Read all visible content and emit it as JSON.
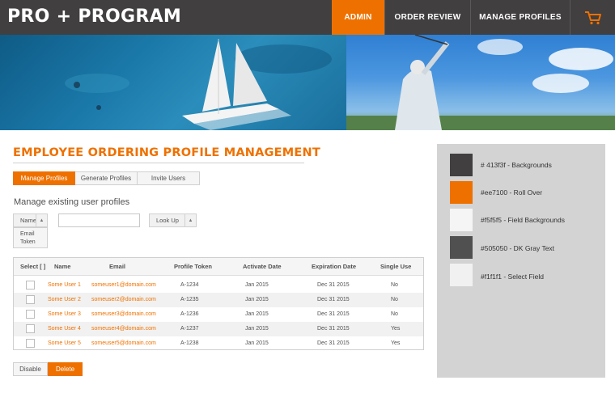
{
  "header": {
    "logo": "PRO + PROGRAM",
    "nav": [
      {
        "label": "ADMIN",
        "active": true
      },
      {
        "label": "ORDER REVIEW",
        "active": false
      },
      {
        "label": "MANAGE PROFILES",
        "active": false
      }
    ],
    "cart_icon": "shopping-cart-icon"
  },
  "page": {
    "title": "EMPLOYEE ORDERING PROFILE MANAGEMENT",
    "tabs": [
      {
        "label": "Manage Profiles",
        "active": true
      },
      {
        "label": "Generate Profiles",
        "active": false
      },
      {
        "label": "Invite Users",
        "active": false
      }
    ],
    "subtitle": "Manage existing user profiles"
  },
  "search": {
    "field_select": "Name",
    "field_options": [
      "Email",
      "Token"
    ],
    "query": "",
    "lookup_label": "Look Up"
  },
  "table": {
    "columns": [
      "Select [ ]",
      "Name",
      "Email",
      "Profile Token",
      "Activate Date",
      "Expiration Date",
      "Single Use"
    ],
    "rows": [
      {
        "name": "Some User 1",
        "email": "someuser1@domain.com",
        "token": "A-1234",
        "activate": "Jan 2015",
        "expiration": "Dec 31 2015",
        "single_use": "No"
      },
      {
        "name": "Some User 2",
        "email": "someuser2@domain.com",
        "token": "A-1235",
        "activate": "Jan 2015",
        "expiration": "Dec 31 2015",
        "single_use": "No"
      },
      {
        "name": "Some User 3",
        "email": "someuser3@domain.com",
        "token": "A-1236",
        "activate": "Jan 2015",
        "expiration": "Dec 31 2015",
        "single_use": "No"
      },
      {
        "name": "Some User 4",
        "email": "someuser4@domain.com",
        "token": "A-1237",
        "activate": "Jan 2015",
        "expiration": "Dec 31 2015",
        "single_use": "Yes"
      },
      {
        "name": "Some User 5",
        "email": "someuser5@domain.com",
        "token": "A-1238",
        "activate": "Jan 2015",
        "expiration": "Dec 31 2015",
        "single_use": "Yes"
      }
    ]
  },
  "actions": {
    "disable_label": "Disable",
    "delete_label": "Delete"
  },
  "legend": [
    {
      "color": "#413f3f",
      "label": "# 413f3f - Backgrounds"
    },
    {
      "color": "#ee7100",
      "label": "#ee7100 - Roll Over"
    },
    {
      "color": "#f5f5f5",
      "label": "#f5f5f5 - Field Backgrounds"
    },
    {
      "color": "#505050",
      "label": "#505050 - DK Gray Text"
    },
    {
      "color": "#f1f1f1",
      "label": "#f1f1f1 - Select Field"
    }
  ]
}
